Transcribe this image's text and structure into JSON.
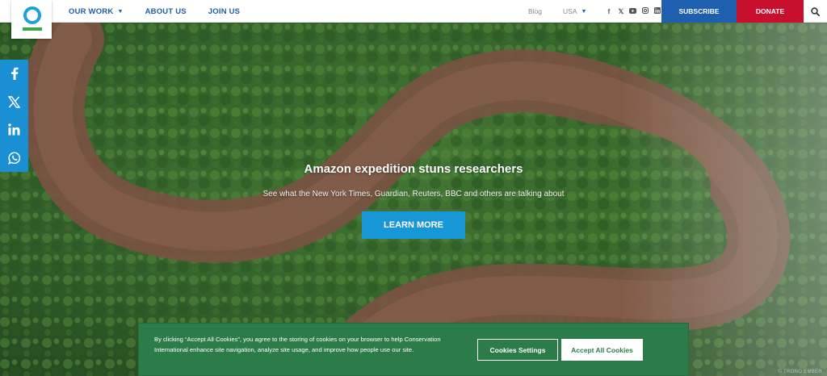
{
  "brand": {
    "logo_icon": "conservation-international-logo"
  },
  "header": {
    "nav": [
      {
        "label": "OUR WORK",
        "has_dropdown": true
      },
      {
        "label": "ABOUT US"
      },
      {
        "label": "JOIN US"
      }
    ],
    "blog_label": "Blog",
    "region_label": "USA",
    "social_icons": [
      "facebook-icon",
      "x-icon",
      "youtube-icon",
      "instagram-icon",
      "linkedin-icon"
    ],
    "subscribe_label": "SUBSCRIBE",
    "donate_label": "DONATE",
    "search_icon": "search-icon"
  },
  "share_bar": {
    "icons": [
      "facebook-icon",
      "x-icon",
      "linkedin-icon",
      "whatsapp-icon"
    ]
  },
  "hero": {
    "title": "Amazon expedition stuns researchers",
    "subtitle": "See what the New York Times, Guardian, Reuters, BBC and others are talking about",
    "cta_label": "LEARN MORE",
    "photo_credit": "© TRONO EMBER"
  },
  "cookie_banner": {
    "text": "By clicking “Accept All Cookies”, you agree to the storing of cookies on your browser to help Conservation International enhance site navigation, analyze site usage, and improve how people use our site.",
    "settings_label": "Cookies Settings",
    "accept_label": "Accept All Cookies"
  },
  "colors": {
    "nav_blue": "#1f5fa3",
    "subscribe_bg": "#1f5fb0",
    "donate_bg": "#c8102e",
    "share_bg": "#1a8fd3",
    "cta_bg": "#1897d6",
    "cookie_bg": "#2c7c4a"
  }
}
